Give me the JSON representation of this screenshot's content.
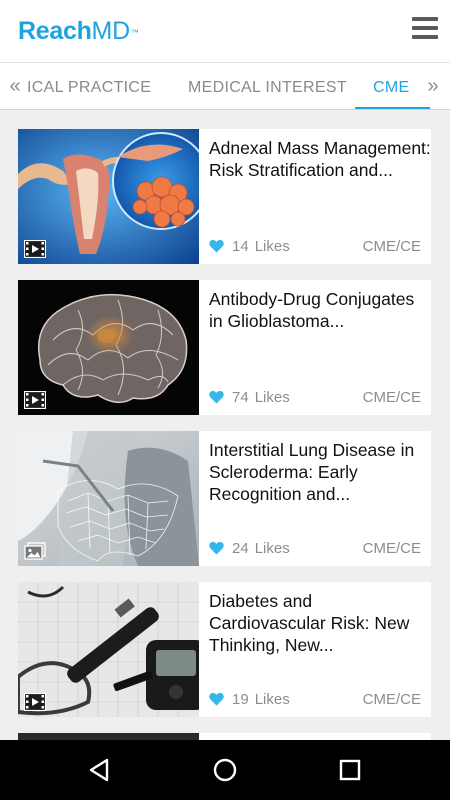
{
  "app": {
    "logo_bold": "Reach",
    "logo_light": "MD",
    "logo_tm": "™"
  },
  "header": {
    "menu_icon": "hamburger-menu-icon"
  },
  "tabs": {
    "items": [
      {
        "label": "CLINICAL PRACTICE",
        "visible_text": "ICAL PRACTICE"
      },
      {
        "label": "MEDICAL INTEREST"
      },
      {
        "label": "CME"
      }
    ],
    "active": "CME",
    "accent_color": "#1fa3e0"
  },
  "articles": [
    {
      "title": "Adnexal Mass Management: Risk Stratification and...",
      "likes": "14",
      "likes_label": "Likes",
      "tag": "CME/CE",
      "media": "video-icon"
    },
    {
      "title": "Antibody-Drug Conjugates in Glioblastoma...",
      "likes": "74",
      "likes_label": "Likes",
      "tag": "CME/CE",
      "media": "video-icon"
    },
    {
      "title": "Interstitial Lung Disease in Scleroderma: Early Recognition and...",
      "likes": "24",
      "likes_label": "Likes",
      "tag": "CME/CE",
      "media": "gallery-icon"
    },
    {
      "title": "Diabetes and Cardiovascular Risk: New Thinking, New...",
      "likes": "19",
      "likes_label": "Likes",
      "tag": "CME/CE",
      "media": "video-icon"
    }
  ],
  "navbar": {
    "back": "back-icon",
    "home": "home-icon",
    "recents": "recents-icon"
  }
}
